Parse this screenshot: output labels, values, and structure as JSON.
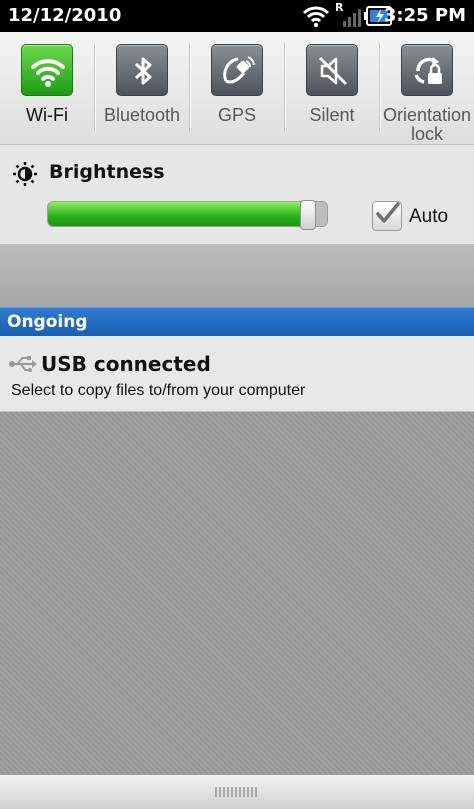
{
  "status_bar": {
    "date": "12/12/2010",
    "time": "3:25 PM",
    "network_letter": "R",
    "icons": [
      "wifi-signal-icon",
      "cell-signal-icon",
      "battery-charging-icon"
    ]
  },
  "toggles": [
    {
      "label": "Wi-Fi",
      "icon": "wifi-icon",
      "active": true
    },
    {
      "label": "Bluetooth",
      "icon": "bluetooth-icon",
      "active": false
    },
    {
      "label": "GPS",
      "icon": "gps-satellite-icon",
      "active": false
    },
    {
      "label": "Silent",
      "icon": "silent-speaker-icon",
      "active": false
    },
    {
      "label": "Orientation lock",
      "icon": "orientation-lock-icon",
      "active": false
    }
  ],
  "brightness": {
    "title": "Brightness",
    "level": 0.96,
    "auto_label": "Auto",
    "auto_checked": true
  },
  "ongoing": {
    "header": "Ongoing",
    "notification": {
      "title": "USB connected",
      "text": "Select to copy files to/from your computer",
      "icon": "usb-icon"
    }
  },
  "colors": {
    "active_toggle": "#2ab01a",
    "header_blue": "#1b5fb0",
    "slider_green": "#2ab01a"
  }
}
